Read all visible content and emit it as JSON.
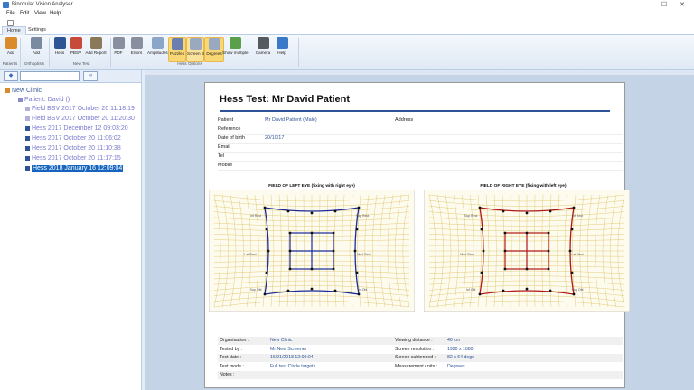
{
  "window": {
    "title": "Binocular Vision Analyser"
  },
  "menu": [
    "File",
    "Edit",
    "View",
    "Help"
  ],
  "tabs": [
    {
      "label": "Home",
      "active": true
    },
    {
      "label": "Settings",
      "active": false
    }
  ],
  "ribbon": {
    "buttons": [
      {
        "id": "add-patient",
        "label": "Add",
        "icon": "add-user-icon",
        "color": "#d98b2b"
      },
      {
        "id": "add-orthoptic",
        "label": "Add",
        "icon": "add-user-icon",
        "color": "#7a8aa0"
      },
      {
        "id": "hess",
        "label": "Hess",
        "icon": "eye-icon",
        "color": "#2f5496"
      },
      {
        "id": "pbsv",
        "label": "PBSV",
        "icon": "colour-wheel-icon",
        "color": "#c84a3a"
      },
      {
        "id": "add-report",
        "label": "Add Report",
        "icon": "report-icon",
        "color": "#8a7a5a"
      },
      {
        "id": "pdf",
        "label": "PDF",
        "icon": "pdf-icon",
        "color": "#8890a0"
      },
      {
        "id": "errors",
        "label": "Errors",
        "icon": "errors-icon",
        "color": "#8890a0"
      },
      {
        "id": "amplitudes",
        "label": "Amplitudes",
        "icon": "chart-icon",
        "color": "#8aa6c8"
      },
      {
        "id": "puzzles",
        "label": "Puzzles",
        "icon": "grid-icon",
        "color": "#6a7fb0"
      },
      {
        "id": "screen-bars",
        "label": "Screen Bars",
        "icon": "bars-icon",
        "color": "#9aa8c0"
      },
      {
        "id": "degrees",
        "label": "Degrees",
        "icon": "degrees-icon",
        "color": "#9aa8c0"
      },
      {
        "id": "show-multiple",
        "label": "Show multiple",
        "icon": "multiple-icon",
        "color": "#5aa04a"
      },
      {
        "id": "camera",
        "label": "Camera",
        "icon": "camera-icon",
        "color": "#555a60"
      },
      {
        "id": "help",
        "label": "Help",
        "icon": "help-icon",
        "color": "#3a78c8"
      }
    ],
    "groups": [
      "Patients",
      "Orthoptists",
      "New Test",
      "Hess Options"
    ]
  },
  "tree": {
    "root": "New Clinic",
    "patient": "Patient: David ()",
    "items": [
      {
        "label": "Field BSV 2017 October 20 11:18:19",
        "type": "field",
        "selected": false
      },
      {
        "label": "Field BSV 2017 October 20 11:20:30",
        "type": "field",
        "selected": false
      },
      {
        "label": "Hess 2017 December 12 09:03:20",
        "type": "hess",
        "selected": false
      },
      {
        "label": "Hess 2017 October 20 11:06:02",
        "type": "hess",
        "selected": false
      },
      {
        "label": "Hess 2017 October 20 11:10:38",
        "type": "hess",
        "selected": false
      },
      {
        "label": "Hess 2017 October 20 11:17:15",
        "type": "hess",
        "selected": false
      },
      {
        "label": "Hess 2018 January 16 12:09:04",
        "type": "hess",
        "selected": true
      }
    ]
  },
  "report": {
    "title": "Hess Test:   Mr David Patient",
    "patient_rows": [
      {
        "label": "Patient",
        "value": "Mr David Patient (Male)"
      },
      {
        "label": "Reference",
        "value": ""
      },
      {
        "label": "Date of birth",
        "value": "20/10/17"
      },
      {
        "label": "Email",
        "value": ""
      },
      {
        "label": "Tel",
        "value": ""
      },
      {
        "label": "Mobile",
        "value": ""
      }
    ],
    "address_label": "Address",
    "charts": [
      {
        "title": "FIELD OF LEFT EYE (fixing with right eye)",
        "color": "#1a2a9a",
        "labels": [
          "Inf Rect",
          "Sup Rect",
          "Lat Rect",
          "Med Rect",
          "Sup Obl",
          "Inf Obl"
        ]
      },
      {
        "title": "FIELD OF RIGHT EYE (fixing with left eye)",
        "color": "#b01818",
        "labels": [
          "Sup Rect",
          "Inf Rect",
          "Med Rect",
          "Lat Rect",
          "Inf Obl",
          "Sup Obl"
        ]
      }
    ],
    "bottom_rows": [
      {
        "l1": "Organisation :",
        "v1": "New Clinic",
        "l2": "Viewing distance :",
        "v2": "40 cm"
      },
      {
        "l1": "Tested by :",
        "v1": "Mr New Screener",
        "l2": "Screen resolution :",
        "v2": "1920 x 1080"
      },
      {
        "l1": "Test date :",
        "v1": "16/01/2018 12:09:04",
        "l2": "Screen subtended :",
        "v2": "82 x 64 degs"
      },
      {
        "l1": "Test mode :",
        "v1": "Full test   Circle targets",
        "l2": "Measurement units :",
        "v2": "Degrees"
      },
      {
        "l1": "Notes :",
        "v1": "",
        "l2": "",
        "v2": ""
      }
    ]
  }
}
